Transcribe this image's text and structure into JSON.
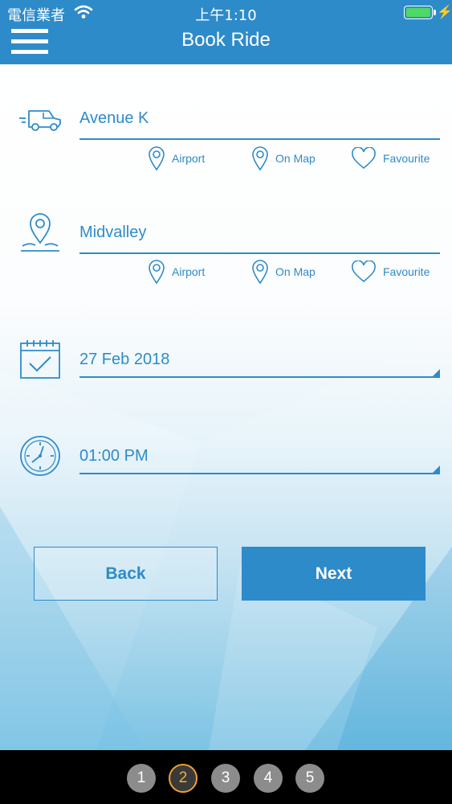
{
  "status_bar": {
    "carrier": "電信業者",
    "time": "上午1:10"
  },
  "header": {
    "title": "Book Ride"
  },
  "pickup": {
    "value": "Avenue K",
    "options": [
      {
        "icon": "pin-icon",
        "label": "Airport"
      },
      {
        "icon": "pin-icon",
        "label": "On Map"
      },
      {
        "icon": "heart-icon",
        "label": "Favourite"
      }
    ]
  },
  "dropoff": {
    "value": "Midvalley",
    "options": [
      {
        "icon": "pin-icon",
        "label": "Airport"
      },
      {
        "icon": "pin-icon",
        "label": "On Map"
      },
      {
        "icon": "heart-icon",
        "label": "Favourite"
      }
    ]
  },
  "date": {
    "value": "27 Feb 2018"
  },
  "time": {
    "value": "01:00 PM"
  },
  "buttons": {
    "back": "Back",
    "next": "Next"
  },
  "pager": {
    "pages": [
      "1",
      "2",
      "3",
      "4",
      "5"
    ],
    "active_index": 1
  },
  "colors": {
    "primary": "#2e8bc9",
    "pager_active_ring": "#f0a030"
  }
}
